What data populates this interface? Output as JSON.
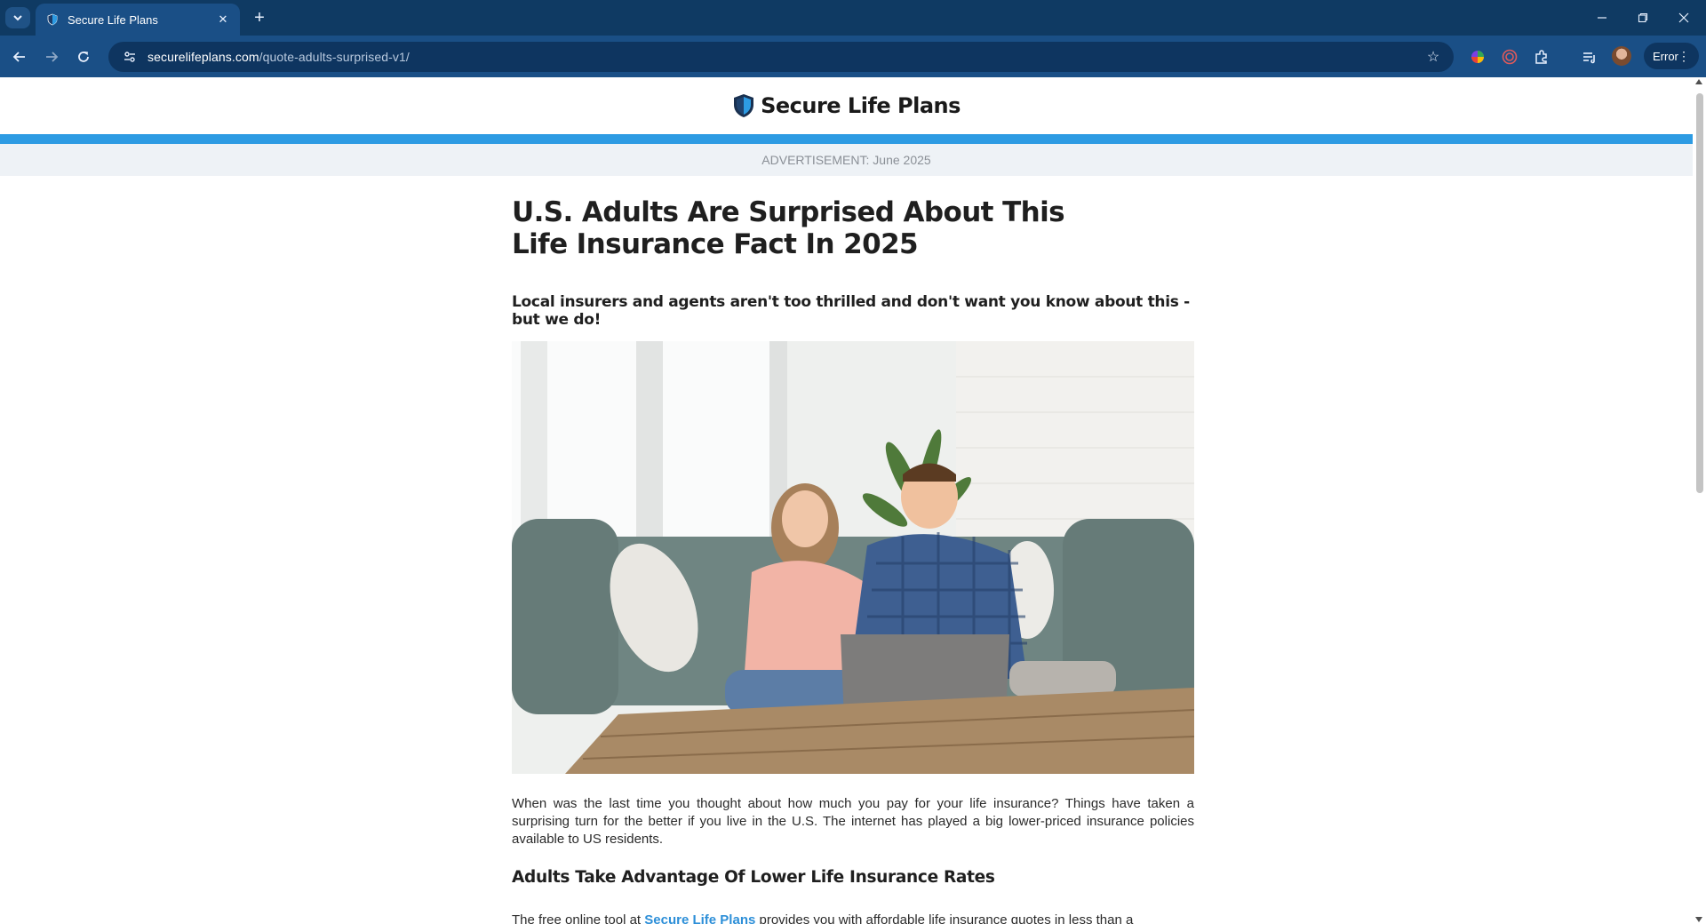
{
  "browser": {
    "tab_title": "Secure Life Plans",
    "url_domain": "securelifeplans.com",
    "url_path": "/quote-adults-surprised-v1/",
    "profile_status": "Error",
    "icons": [
      "tab-search-icon",
      "close-icon",
      "plus-icon",
      "minimize-icon",
      "restore-icon",
      "close-window-icon",
      "back-icon",
      "forward-icon",
      "reload-icon",
      "site-info-icon",
      "star-icon",
      "extensions-icon",
      "media-icon",
      "more-vert-icon"
    ]
  },
  "site": {
    "logo_text": "Secure Life Plans",
    "ad_label": "ADVERTISEMENT: June 2025",
    "brand_color": "#2d9be3"
  },
  "article": {
    "headline": "U.S. Adults Are Surprised About This Life Insurance Fact In 2025",
    "subhead": "Local insurers and agents aren't too thrilled and don't want you know about this - but we do!",
    "paragraph1": "When was the last time you thought about how much you pay for your life insurance? Things have taken a surprising turn for the better if you live in the U.S. The internet has played a big lower-priced insurance policies available to US residents.",
    "heading2": "Adults Take Advantage Of Lower Life Insurance Rates",
    "paragraph2_before": "The free online tool at",
    "paragraph2_link": "Secure Life Plans",
    "paragraph2_after": "provides you with affordable life insurance quotes in less than a"
  }
}
